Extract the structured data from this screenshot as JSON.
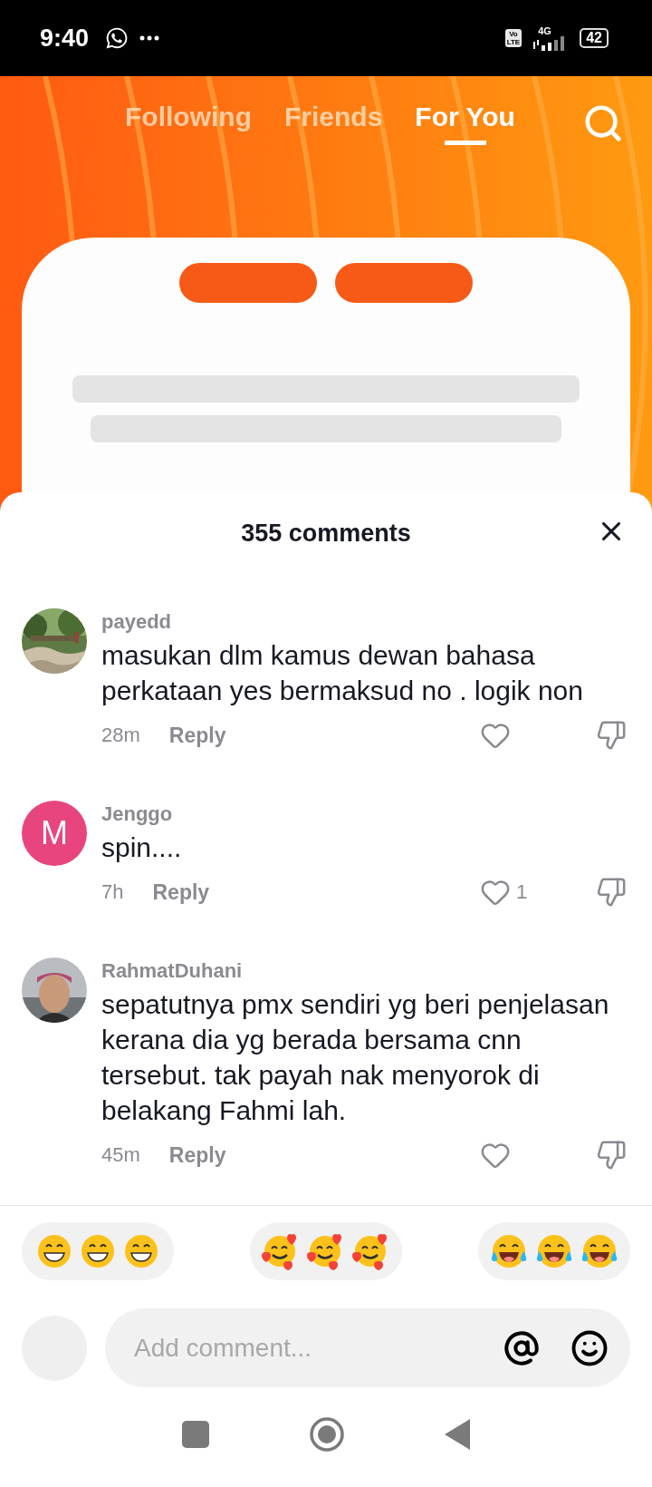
{
  "status_bar": {
    "time": "9:40",
    "volte": [
      "Vo",
      "LTE"
    ],
    "network": "4G",
    "battery": "42"
  },
  "top_tabs": [
    {
      "label": "Following",
      "selected": false
    },
    {
      "label": "Friends",
      "selected": false
    },
    {
      "label": "For You",
      "selected": true
    }
  ],
  "comments_sheet": {
    "title": "355 comments",
    "comments": [
      {
        "username": "payedd",
        "text": "masukan dlm kamus dewan bahasa perkataan yes bermaksud no . logik non",
        "time": "28m",
        "reply": "Reply"
      },
      {
        "username": "Jenggo",
        "avatar": {
          "kind": "letter",
          "letter": "M",
          "color": "#e8457f"
        },
        "text": "spin....",
        "time": "7h",
        "reply": "Reply",
        "likes": "1"
      },
      {
        "username": "RahmatDuhani",
        "avatar": {
          "kind": "person"
        },
        "text": "sepatutnya pmx sendiri yg beri penjelasan kerana dia yg berada bersama cnn tersebut. tak payah nak menyorok di belakang Fahmi lah.",
        "time": "45m",
        "reply": "Reply"
      }
    ]
  },
  "quick_reactions": [
    {
      "kind": "grin"
    },
    {
      "kind": "hearts"
    },
    {
      "kind": "tears"
    }
  ],
  "composer": {
    "placeholder": "Add comment..."
  }
}
